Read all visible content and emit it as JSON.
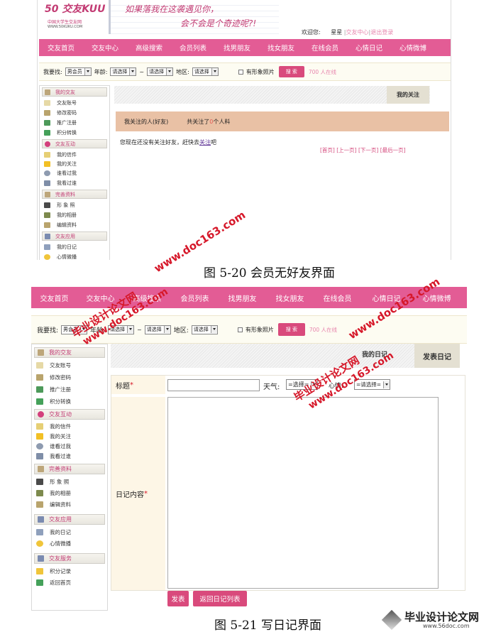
{
  "header": {
    "logo_title": "50 交友KUU",
    "logo_cn": "中国大学生交友网",
    "logo_url": "WWW.50KUKU.COM",
    "slogan_line1": "如果落我在这袭遇见你，",
    "slogan_line2": "会不会是个奇迹呢?!",
    "welcome": "欢迎您:",
    "username": "星星",
    "link_center": "交友中心",
    "link_logout": "退出登录",
    "sep": "|"
  },
  "nav": [
    "交友首页",
    "交友中心",
    "高级搜索",
    "会员列表",
    "找男朋友",
    "找女朋友",
    "在线会员",
    "心情日记",
    "心情微博"
  ],
  "search": {
    "find_label": "我要找:",
    "find_value": "男会员",
    "find_value_2": "男会员",
    "age_label": "年龄:",
    "select_placeholder": "请选择",
    "tilde": "~",
    "region_label": "地区:",
    "photo_label": "有形象照片",
    "search_btn": "搜 索",
    "online": "700 人在线"
  },
  "sidebar": {
    "groups": [
      {
        "title": "我的交友",
        "items": [
          "交友账号",
          "修改密码",
          "推广注册",
          "积分转换"
        ]
      },
      {
        "title": "交友互动",
        "items": [
          "我的信件",
          "我的关注",
          "谁看过我",
          "我看过谁"
        ]
      },
      {
        "title": "完善资料",
        "items": [
          "形 象 照",
          "我的相册",
          "编辑资料"
        ]
      },
      {
        "title": "交友应用",
        "items": [
          "我的日记",
          "心情微播"
        ]
      },
      {
        "title": "交友服务",
        "items": [
          "积分记录",
          "返回首页"
        ]
      }
    ]
  },
  "fig1": {
    "tab": "我的关注",
    "band_left": "我关注的人(好友)",
    "band_right_a": "共关注了",
    "band_right_n": "0",
    "band_right_b": "个人料",
    "empty_a": "您现在还没有关注好友，赶快去",
    "empty_link": "关注",
    "empty_b": "吧",
    "pager": [
      "[首页]",
      "[上一页]",
      "[下一页]",
      "[最后一页]"
    ],
    "caption": "图 5-20  会员无好友界面"
  },
  "fig2": {
    "tab_active": "我的日记",
    "tab_right": "发表日记",
    "title_label": "标题",
    "required": "*",
    "weather_label": "天气:",
    "weather_value": "=选择=",
    "mood_label": "心情:",
    "mood_value": "=请选择=",
    "content_label": "日记内容",
    "btn_publish": "发表",
    "btn_back": "返回日记列表",
    "caption": "图 5-21    写日记界面"
  },
  "watermarks": {
    "doc": "www.doc163.com",
    "cn": "毕业设计论文网",
    "footer_cn": "毕业设计论文网",
    "footer_url": "www.56doc.com"
  },
  "colors": {
    "nav": "#e35c95",
    "accent": "#d94a7c",
    "band": "#e9c1a5",
    "watermark": "#d6182a"
  }
}
